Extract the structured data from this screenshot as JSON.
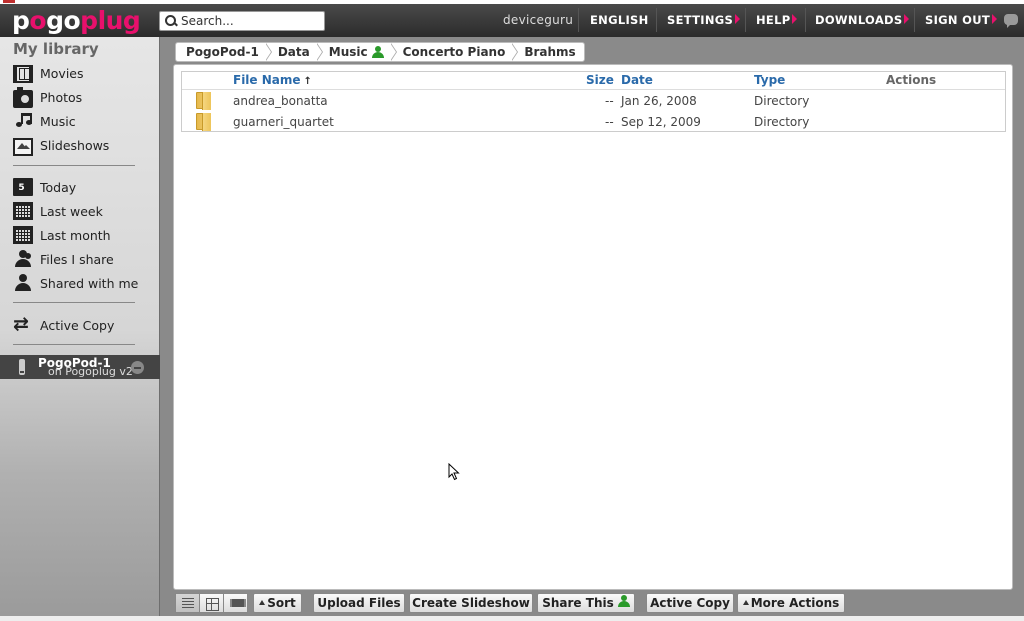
{
  "header": {
    "logo_a": "p",
    "logo_b": "o",
    "logo_c": "go",
    "logo_d": "plug",
    "search_placeholder": "Search...",
    "username": "deviceguru",
    "nav": [
      "ENGLISH",
      "SETTINGS",
      "HELP",
      "DOWNLOADS",
      "SIGN OUT"
    ]
  },
  "sidebar": {
    "title": "My library",
    "media": [
      "Movies",
      "Photos",
      "Music",
      "Slideshows"
    ],
    "time": [
      "Today",
      "Last week",
      "Last month",
      "Files I share",
      "Shared with me"
    ],
    "calendar_day": "5",
    "active_copy": "Active Copy",
    "device_name": "PogoPod-1",
    "device_sub": "on Pogoplug v2"
  },
  "breadcrumb": [
    "PogoPod-1",
    "Data",
    "Music",
    "Concerto Piano",
    "Brahms"
  ],
  "table": {
    "columns": {
      "name": "File Name",
      "size": "Size",
      "date": "Date",
      "type": "Type",
      "actions": "Actions"
    },
    "rows": [
      {
        "name": "andrea_bonatta",
        "size": "--",
        "date": "Jan 26, 2008",
        "type": "Directory"
      },
      {
        "name": "guarneri_quartet",
        "size": "--",
        "date": "Sep 12, 2009",
        "type": "Directory"
      }
    ]
  },
  "toolbar": {
    "sort": "Sort",
    "upload": "Upload Files",
    "slideshow": "Create Slideshow",
    "share": "Share This",
    "active_copy": "Active Copy",
    "more": "More Actions"
  },
  "colors": {
    "brand": "#e8106c",
    "link": "#2a6aaa",
    "share": "#2a9a2a"
  }
}
